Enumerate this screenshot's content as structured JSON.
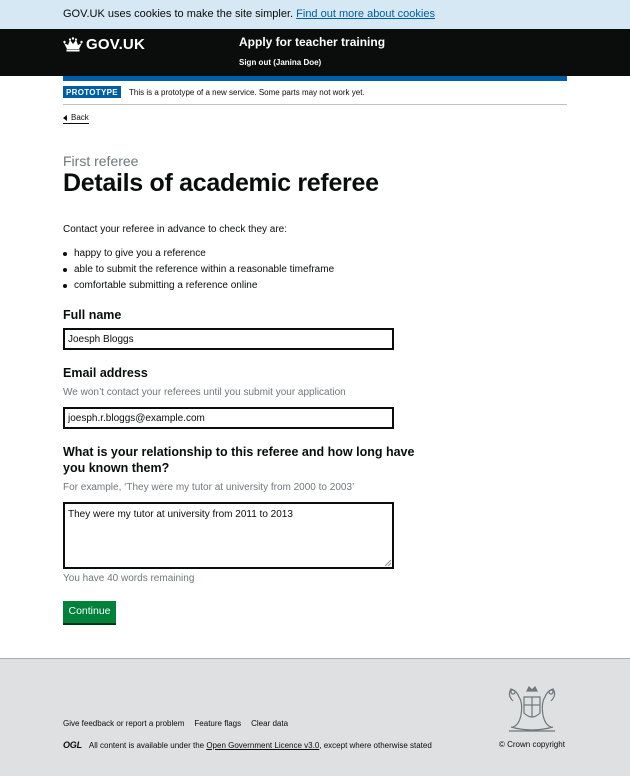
{
  "cookie_banner": {
    "text": "GOV.UK uses cookies to make the site simpler.",
    "link": "Find out more about cookies"
  },
  "header": {
    "logo_text": "GOV.UK",
    "logo_icon": "crown-icon",
    "service_name": "Apply for teacher training",
    "sign_out": "Sign out (Janina Doe)"
  },
  "phase_banner": {
    "tag": "PROTOTYPE",
    "text": "This is a prototype of a new service. Some parts may not work yet."
  },
  "back_link": "Back",
  "page": {
    "caption": "First referee",
    "title": "Details of academic referee",
    "intro": "Contact your referee in advance to check they are:",
    "bullets": [
      "happy to give you a reference",
      "able to submit the reference within a reasonable timeframe",
      "comfortable submitting a reference online"
    ]
  },
  "form": {
    "full_name": {
      "label": "Full name",
      "value": "Joesph Bloggs"
    },
    "email": {
      "label": "Email address",
      "hint": "We won’t contact your referees until you submit your application",
      "value": "joesph.r.bloggs@example.com"
    },
    "relationship": {
      "label_line1": "What is your relationship to this referee and how long have",
      "label_line2": "you known them?",
      "hint": "For example, ‘They were my tutor at university from 2000 to 2003’",
      "value": "They were my tutor at university from 2011 to 2013",
      "word_count": "You have 40 words remaining"
    },
    "continue_label": "Continue"
  },
  "footer": {
    "links": [
      "Give feedback or report a problem",
      "Feature flags",
      "Clear data"
    ],
    "ogl_logo": "OGL",
    "licence_prefix": "All content is available under the",
    "licence_link": "Open Government Licence v3.0",
    "licence_suffix": ", except where otherwise stated",
    "copyright": "© Crown copyright",
    "crest_icon": "royal-coat-of-arms-icon"
  },
  "colors": {
    "header_bg": "#0b0c0c",
    "brand_blue": "#005ea5",
    "button_green": "#00823b",
    "cookie_bg": "#d5e8f3",
    "footer_bg": "#dee0e2"
  }
}
